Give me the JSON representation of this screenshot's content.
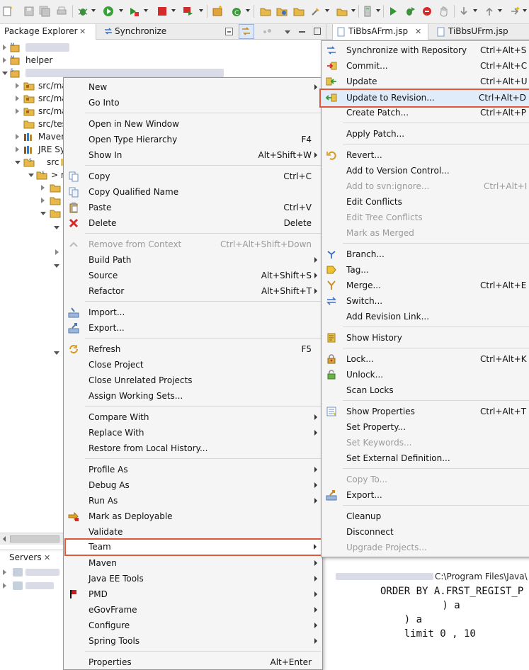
{
  "left_view": {
    "tabs": [
      {
        "label": "Package Explorer"
      },
      {
        "label": "Synchronize"
      }
    ],
    "tree": [
      {
        "label": ""
      },
      {
        "label": "helper"
      },
      {
        "label": ""
      },
      {
        "label": "src/ma"
      },
      {
        "label": "src/ma"
      },
      {
        "label": "src/ma"
      },
      {
        "label": "src/tes"
      },
      {
        "label": "Maven"
      },
      {
        "label": "JRE Sys"
      },
      {
        "label": "src"
      },
      {
        "label": "> n"
      }
    ]
  },
  "servers_view": {
    "tab_label": "Servers"
  },
  "editor": {
    "tabs": [
      {
        "label": "TiBbsAFrm.jsp"
      },
      {
        "label": "TiBbsUFrm.jsp"
      }
    ],
    "console_title": "C:\\Program Files\\Java\\",
    "code_lines": [
      "ORDER BY A.FRST_REGIST_P",
      "        ) a",
      "    ) a",
      "    limit 0 , 10"
    ]
  },
  "context_menu": {
    "items": [
      {
        "label": "New",
        "submenu": true
      },
      {
        "label": "Go Into"
      },
      {
        "separator": true
      },
      {
        "label": "Open in New Window"
      },
      {
        "label": "Open Type Hierarchy",
        "shortcut": "F4"
      },
      {
        "label": "Show In",
        "shortcut": "Alt+Shift+W",
        "submenu": true
      },
      {
        "separator": true
      },
      {
        "label": "Copy",
        "shortcut": "Ctrl+C",
        "icon": "copy-icon"
      },
      {
        "label": "Copy Qualified Name",
        "icon": "copy-qualified-icon"
      },
      {
        "label": "Paste",
        "shortcut": "Ctrl+V",
        "icon": "paste-icon"
      },
      {
        "label": "Delete",
        "shortcut": "Delete",
        "icon": "delete-icon"
      },
      {
        "separator": true
      },
      {
        "label": "Remove from Context",
        "shortcut": "Ctrl+Alt+Shift+Down",
        "disabled": true,
        "icon": "remove-context-icon"
      },
      {
        "label": "Build Path",
        "submenu": true
      },
      {
        "label": "Source",
        "shortcut": "Alt+Shift+S",
        "submenu": true
      },
      {
        "label": "Refactor",
        "shortcut": "Alt+Shift+T",
        "submenu": true
      },
      {
        "separator": true
      },
      {
        "label": "Import...",
        "icon": "import-icon"
      },
      {
        "label": "Export...",
        "icon": "export-icon"
      },
      {
        "separator": true
      },
      {
        "label": "Refresh",
        "shortcut": "F5",
        "icon": "refresh-icon"
      },
      {
        "label": "Close Project"
      },
      {
        "label": "Close Unrelated Projects"
      },
      {
        "label": "Assign Working Sets..."
      },
      {
        "separator": true
      },
      {
        "label": "Compare With",
        "submenu": true
      },
      {
        "label": "Replace With",
        "submenu": true
      },
      {
        "label": "Restore from Local History..."
      },
      {
        "separator": true
      },
      {
        "label": "Profile As",
        "submenu": true
      },
      {
        "label": "Debug As",
        "submenu": true
      },
      {
        "label": "Run As",
        "submenu": true
      },
      {
        "label": "Mark as Deployable",
        "icon": "deployable-icon"
      },
      {
        "label": "Validate"
      },
      {
        "label": "Team",
        "submenu": true,
        "highlighted": true
      },
      {
        "label": "Maven",
        "submenu": true
      },
      {
        "label": "Java EE Tools",
        "submenu": true
      },
      {
        "label": "PMD",
        "submenu": true,
        "icon": "pmd-icon"
      },
      {
        "label": "eGovFrame",
        "submenu": true
      },
      {
        "label": "Configure",
        "submenu": true
      },
      {
        "label": "Spring Tools",
        "submenu": true
      },
      {
        "separator": true
      },
      {
        "label": "Properties",
        "shortcut": "Alt+Enter"
      }
    ]
  },
  "team_submenu": {
    "items": [
      {
        "label": "Synchronize with Repository",
        "shortcut": "Ctrl+Alt+S",
        "icon": "synchronize-icon"
      },
      {
        "label": "Commit...",
        "shortcut": "Ctrl+Alt+C",
        "icon": "commit-icon"
      },
      {
        "label": "Update",
        "shortcut": "Ctrl+Alt+U",
        "icon": "update-icon"
      },
      {
        "label": "Update to Revision...",
        "shortcut": "Ctrl+Alt+D",
        "icon": "update-revision-icon",
        "highlighted": true
      },
      {
        "label": "Create Patch...",
        "shortcut": "Ctrl+Alt+P"
      },
      {
        "separator": true
      },
      {
        "label": "Apply Patch..."
      },
      {
        "separator": true
      },
      {
        "label": "Revert...",
        "icon": "revert-icon"
      },
      {
        "label": "Add to Version Control..."
      },
      {
        "label": "Add to svn:ignore...",
        "shortcut": "Ctrl+Alt+I",
        "disabled": true
      },
      {
        "label": "Edit Conflicts"
      },
      {
        "label": "Edit Tree Conflicts",
        "disabled": true
      },
      {
        "label": "Mark as Merged",
        "disabled": true
      },
      {
        "separator": true
      },
      {
        "label": "Branch...",
        "icon": "branch-icon"
      },
      {
        "label": "Tag...",
        "icon": "tag-icon"
      },
      {
        "label": "Merge...",
        "shortcut": "Ctrl+Alt+E",
        "icon": "merge-icon"
      },
      {
        "label": "Switch...",
        "icon": "switch-icon"
      },
      {
        "label": "Add Revision Link..."
      },
      {
        "separator": true
      },
      {
        "label": "Show History",
        "icon": "history-icon"
      },
      {
        "separator": true
      },
      {
        "label": "Lock...",
        "shortcut": "Ctrl+Alt+K",
        "icon": "lock-icon"
      },
      {
        "label": "Unlock...",
        "icon": "unlock-icon"
      },
      {
        "label": "Scan Locks"
      },
      {
        "separator": true
      },
      {
        "label": "Show Properties",
        "shortcut": "Ctrl+Alt+T",
        "icon": "properties-icon"
      },
      {
        "label": "Set Property..."
      },
      {
        "label": "Set Keywords...",
        "disabled": true
      },
      {
        "label": "Set External Definition..."
      },
      {
        "separator": true
      },
      {
        "label": "Copy To...",
        "disabled": true
      },
      {
        "label": "Export...",
        "icon": "export-icon"
      },
      {
        "separator": true
      },
      {
        "label": "Cleanup"
      },
      {
        "label": "Disconnect"
      },
      {
        "label": "Upgrade Projects...",
        "disabled": true
      }
    ]
  }
}
